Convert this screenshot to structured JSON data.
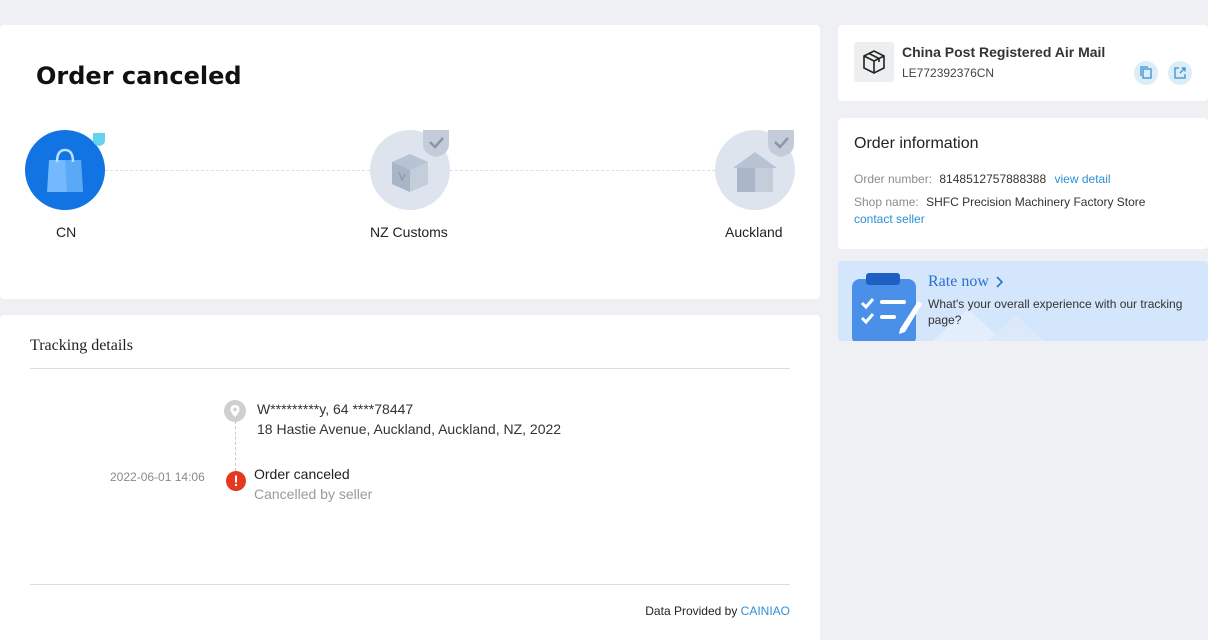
{
  "status": {
    "title": "Order canceled",
    "nodes": [
      {
        "label": "CN",
        "icon": "shopping-bag-icon",
        "state": "current"
      },
      {
        "label": "NZ Customs",
        "icon": "package-icon",
        "state": "pending"
      },
      {
        "label": "Auckland",
        "icon": "house-icon",
        "state": "pending"
      }
    ]
  },
  "tracking": {
    "title": "Tracking details",
    "address": {
      "line1": "W*********y,  64 ****78447",
      "line2": "18 Hastie Avenue,  Auckland,  Auckland,  NZ,  2022"
    },
    "events": [
      {
        "time": "2022-06-01 14:06",
        "title": "Order canceled",
        "subtitle": "Cancelled by seller"
      }
    ],
    "footer": {
      "prefix": "Data Provided by ",
      "provider": "CAINIAO"
    }
  },
  "carrier": {
    "name": "China Post Registered Air Mail",
    "tracking_number": "LE772392376CN"
  },
  "order": {
    "title": "Order information",
    "number_label": "Order number:",
    "number": "8148512757888388",
    "view_detail": "view detail",
    "shop_label": "Shop name:",
    "shop_name": "SHFC Precision Machinery Factory Store",
    "contact": "contact seller"
  },
  "rate": {
    "title": "Rate now",
    "description": "What's your overall experience with our tracking page?"
  },
  "colors": {
    "accent": "#1273e3",
    "link": "#2c8fd6",
    "error": "#e4381f",
    "node_grey": "#dde4ee"
  }
}
